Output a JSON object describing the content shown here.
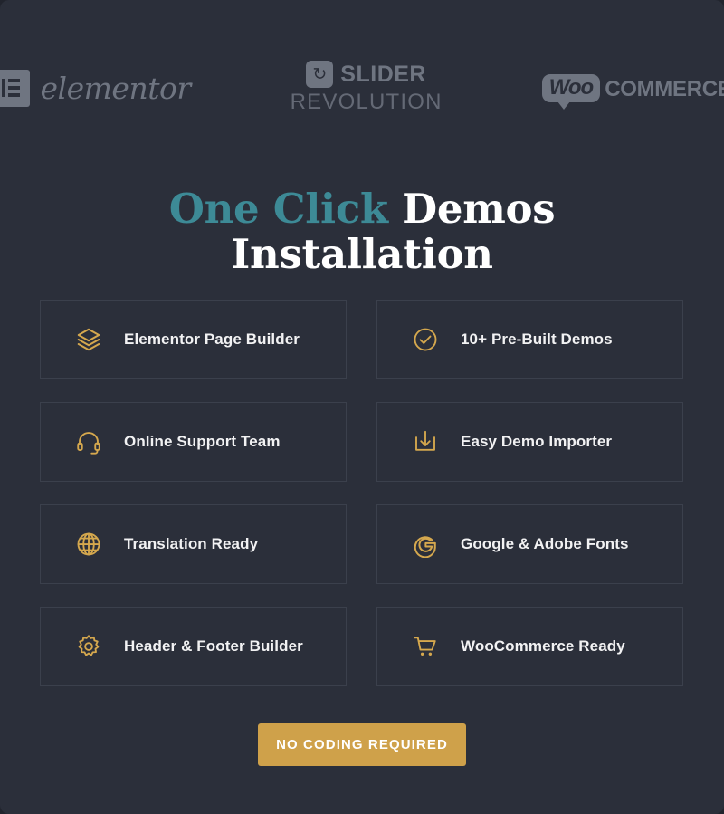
{
  "brand_logos": [
    {
      "name": "elementor-logo",
      "text": "elementor"
    },
    {
      "name": "slider-revolution-logo",
      "line1": "SLIDER",
      "line2": "REVOLUTION",
      "mark": "↻"
    },
    {
      "name": "woocommerce-logo",
      "mark": "Woo",
      "text": "COMMERCE"
    }
  ],
  "heading": {
    "accent_text": "One Click",
    "rest_text": " Demos",
    "line2": "Installation",
    "accent_color": "#3d8a96",
    "color": "#ffffff"
  },
  "features": [
    {
      "icon": "layers-icon",
      "label": "Elementor Page Builder"
    },
    {
      "icon": "check-circle-icon",
      "label": "10+ Pre-Built Demos"
    },
    {
      "icon": "headset-icon",
      "label": "Online Support Team"
    },
    {
      "icon": "download-box-icon",
      "label": "Easy Demo Importer"
    },
    {
      "icon": "globe-icon",
      "label": "Translation Ready"
    },
    {
      "icon": "google-g-icon",
      "label": "Google & Adobe Fonts"
    },
    {
      "icon": "gear-icon",
      "label": "Header & Footer Builder"
    },
    {
      "icon": "shopping-cart-icon",
      "label": "WooCommerce Ready"
    }
  ],
  "cta": {
    "label": "NO CODING REQUIRED",
    "background": "#cfa14a"
  },
  "theme": {
    "page_background": "#2b2f3a",
    "card_border": "#3b404c",
    "icon_gold": "#d5a84e",
    "logo_grey": "#9aa0ad"
  }
}
